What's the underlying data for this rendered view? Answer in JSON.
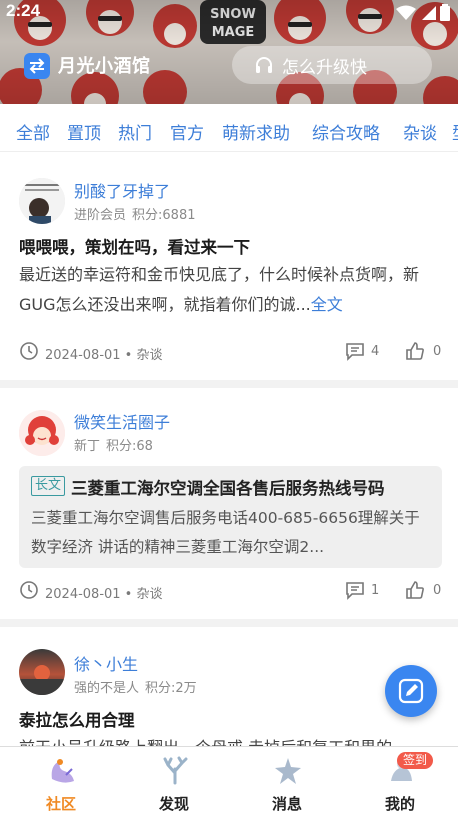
{
  "status": {
    "time": "2:24"
  },
  "header": {
    "club_name": "月光小酒馆",
    "search_placeholder": "怎么升级快",
    "banner_text": "SNOW MAGE"
  },
  "tabs": [
    "全部",
    "置顶",
    "热门",
    "官方",
    "萌新求助",
    "综合攻略",
    "杂谈",
    "型"
  ],
  "posts": [
    {
      "author": "别酸了牙掉了",
      "level": "进阶会员",
      "points": "积分:6881",
      "title": "喂喂喂，策划在吗，看过来一下",
      "excerpt": "最近送的幸运符和金币快见底了，什么时候补点货啊，新GUG怎么还没出来啊，就指着你们的诚...",
      "more": "全文",
      "date": "2024-08-01 • 杂谈",
      "comments": "4",
      "likes": "0"
    },
    {
      "author": "微笑生活圈子",
      "level": "新丁",
      "points": "积分:68",
      "quote_tag": "长文",
      "quote_title": "三菱重工海尔空调全国各售后服务热线号码",
      "quote_body": "三菱重工海尔空调售后服务电话400-685-6656理解关于数字经济 讲话的精神三菱重工海尔空调2...",
      "date": "2024-08-01 • 杂谈",
      "comments": "1",
      "likes": "0"
    },
    {
      "author": "徐丶小生",
      "level": "强的不是人",
      "points": "积分:2万",
      "title": "泰拉怎么用合理",
      "excerpt": "前天小号升级路上翻出一个母戒 走掉后和复工和界的"
    }
  ],
  "bottom_nav": [
    {
      "label": "社区",
      "active": true
    },
    {
      "label": "发现",
      "active": false
    },
    {
      "label": "消息",
      "active": false
    },
    {
      "label": "我的",
      "active": false,
      "badge": "签到"
    }
  ],
  "colors": {
    "accent": "#3d7ed8",
    "active_nav": "#f08a24",
    "badge": "#f25a4a"
  }
}
